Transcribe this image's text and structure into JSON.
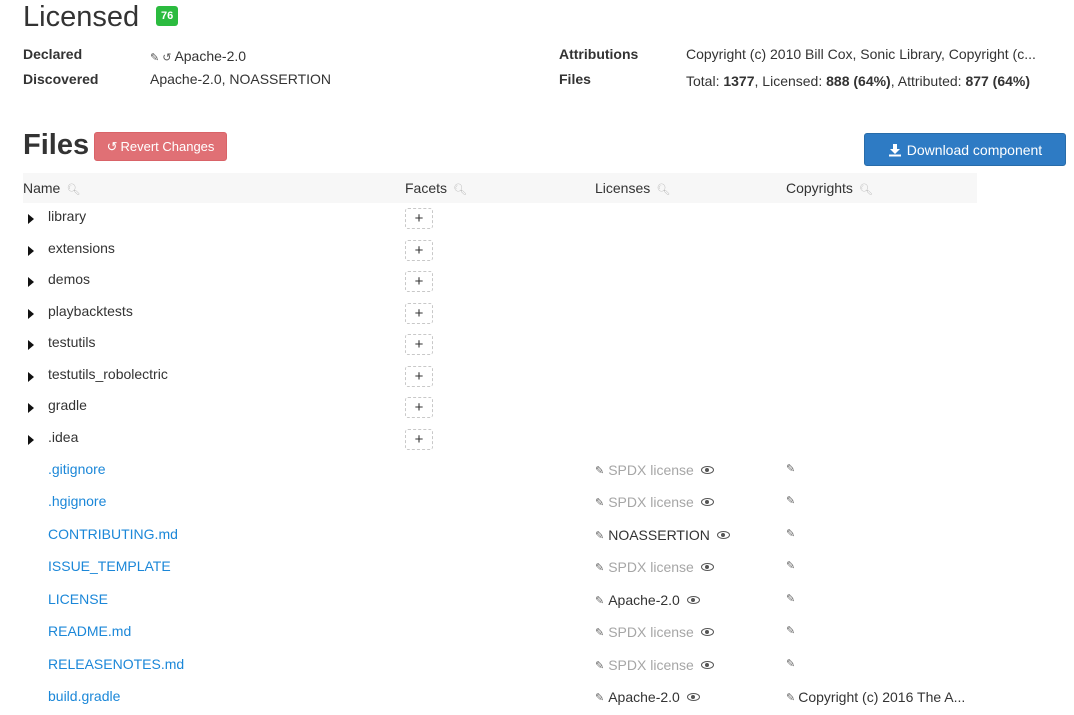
{
  "licensed": {
    "title": "Licensed",
    "score": "76",
    "declared_label": "Declared",
    "declared_value": "Apache-2.0",
    "discovered_label": "Discovered",
    "discovered_value": "Apache-2.0, NOASSERTION",
    "attributions_label": "Attributions",
    "attributions_value": "Copyright (c) 2010 Bill Cox, Sonic Library, Copyright (c...",
    "files_label": "Files",
    "files_total_label": "Total: ",
    "files_total": "1377",
    "files_licensed_label": ", Licensed: ",
    "files_licensed": "888 (64%)",
    "files_attributed_label": ", Attributed: ",
    "files_attributed": "877 (64%)"
  },
  "files_section": {
    "title": "Files",
    "revert_label": "Revert Changes",
    "download_label": "Download component"
  },
  "table": {
    "columns": [
      "Name",
      "Facets",
      "Licenses",
      "Copyrights"
    ],
    "folders": [
      {
        "name": "library"
      },
      {
        "name": "extensions"
      },
      {
        "name": "demos"
      },
      {
        "name": "playbacktests"
      },
      {
        "name": "testutils"
      },
      {
        "name": "testutils_robolectric"
      },
      {
        "name": "gradle"
      },
      {
        "name": ".idea"
      }
    ],
    "files": [
      {
        "name": ".gitignore",
        "license": "SPDX license",
        "license_style": "muted",
        "copyright": ""
      },
      {
        "name": ".hgignore",
        "license": "SPDX license",
        "license_style": "muted",
        "copyright": ""
      },
      {
        "name": "CONTRIBUTING.md",
        "license": "NOASSERTION",
        "license_style": "normal",
        "copyright": ""
      },
      {
        "name": "ISSUE_TEMPLATE",
        "license": "SPDX license",
        "license_style": "muted",
        "copyright": ""
      },
      {
        "name": "LICENSE",
        "license": "Apache-2.0",
        "license_style": "normal",
        "copyright": ""
      },
      {
        "name": "README.md",
        "license": "SPDX license",
        "license_style": "muted",
        "copyright": ""
      },
      {
        "name": "RELEASENOTES.md",
        "license": "SPDX license",
        "license_style": "muted",
        "copyright": ""
      },
      {
        "name": "build.gradle",
        "license": "Apache-2.0",
        "license_style": "normal",
        "copyright": "Copyright (c) 2016 The A..."
      }
    ]
  },
  "colors": {
    "score_badge": "#2bbb3f",
    "revert_button": "#e07075",
    "download_button": "#2e7bc4",
    "file_link": "#1b87d8"
  },
  "icons": {
    "edit": "pencil-icon",
    "revert": "undo-icon",
    "search": "search-icon",
    "view": "eye-icon",
    "download": "download-icon",
    "expand": "caret-right-icon",
    "facet_add": "plus-icon"
  }
}
